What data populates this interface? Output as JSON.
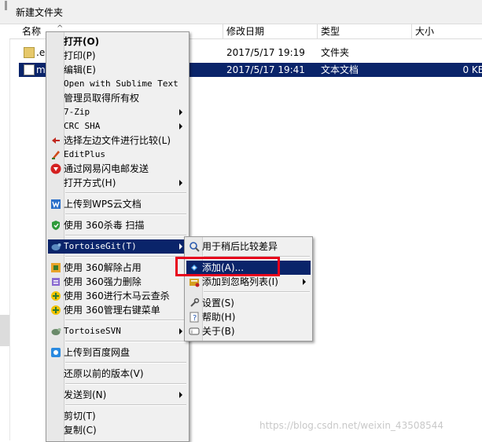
{
  "toolbar": {
    "new_folder": "新建文件夹"
  },
  "columns": {
    "name": "名称",
    "date": "修改日期",
    "type": "类型",
    "size": "大小"
  },
  "files": [
    {
      "name": ".e",
      "date": "2017/5/17 19:19",
      "type": "文件夹",
      "size": "",
      "icon": "folder-icon"
    },
    {
      "name": "my",
      "date": "2017/5/17 19:41",
      "type": "文本文档",
      "size": "0 KB",
      "icon": "text-file-icon"
    }
  ],
  "context_menu": {
    "items": [
      {
        "label": "打开(O)",
        "bold": true
      },
      {
        "label": "打印(P)"
      },
      {
        "label": "编辑(E)"
      },
      {
        "label": "Open with Sublime Text"
      },
      {
        "label": "管理员取得所有权"
      },
      {
        "label": "7-Zip",
        "submenu": true
      },
      {
        "label": "CRC SHA",
        "submenu": true
      },
      {
        "label": "选择左边文件进行比较(L)",
        "icon": "compare-icon"
      },
      {
        "label": "EditPlus",
        "icon": "editplus-icon"
      },
      {
        "label": "通过网易闪电邮发送",
        "icon": "netease-mail-icon"
      },
      {
        "label": "打开方式(H)",
        "submenu": true
      },
      {
        "label": "上传到WPS云文档",
        "icon": "wps-cloud-icon"
      },
      {
        "label": "使用 360杀毒 扫描",
        "icon": "360-antivirus-icon"
      },
      {
        "label": "TortoiseGit(T)",
        "icon": "tortoisegit-icon",
        "submenu": true,
        "highlighted": true
      },
      {
        "label": "使用 360解除占用",
        "icon": "360-unlock-icon"
      },
      {
        "label": "使用 360强力删除",
        "icon": "360-shred-icon"
      },
      {
        "label": "使用 360进行木马云查杀",
        "icon": "360-trojan-scan-icon"
      },
      {
        "label": "使用 360管理右键菜单",
        "icon": "360-menu-manager-icon"
      },
      {
        "label": "TortoiseSVN",
        "icon": "tortoisesvn-icon",
        "submenu": true
      },
      {
        "label": "上传到百度网盘",
        "icon": "baidu-netdisk-icon"
      },
      {
        "label": "还原以前的版本(V)"
      },
      {
        "label": "发送到(N)",
        "submenu": true
      },
      {
        "label": "剪切(T)"
      },
      {
        "label": "复制(C)"
      }
    ]
  },
  "tortoisegit_submenu": {
    "items": [
      {
        "label": "用于稍后比较差异",
        "icon": "diff-later-icon"
      },
      {
        "label": "添加(A)...",
        "icon": "add-icon",
        "highlighted": true
      },
      {
        "label": "添加到忽略列表(I)",
        "icon": "ignore-list-icon",
        "submenu": true
      },
      {
        "label": "设置(S)",
        "icon": "settings-icon"
      },
      {
        "label": "帮助(H)",
        "icon": "help-icon"
      },
      {
        "label": "关于(B)",
        "icon": "about-icon"
      }
    ]
  },
  "watermark": "https://blog.csdn.net/weixin_43508544",
  "colors": {
    "selection": "#0a246a",
    "menu_bg": "#f0f0f0",
    "highlight_box": "#e8001c"
  }
}
